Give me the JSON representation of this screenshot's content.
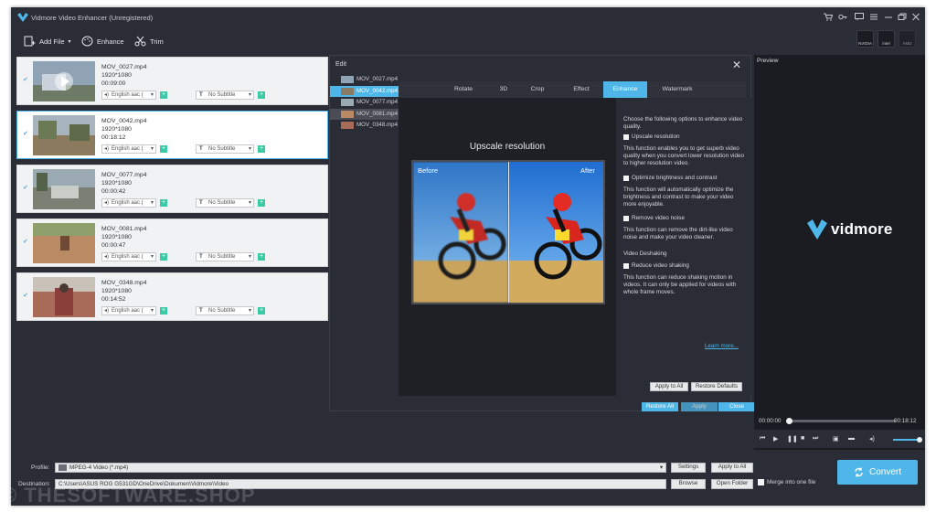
{
  "window": {
    "title": "Vidmore Video Enhancer (Unregistered)"
  },
  "title_icons": [
    "cart-icon",
    "key-icon",
    "chat-icon",
    "menu-icon",
    "minimize-icon",
    "restore-icon",
    "close-icon"
  ],
  "toolbar": {
    "add_file": "Add File",
    "enhance": "Enhance",
    "trim": "Trim"
  },
  "gpu_badges": [
    "NVIDIA",
    "intel",
    "AMD"
  ],
  "files": [
    {
      "name": "MOV_0027.mp4",
      "resolution": "1920*1080",
      "duration": "00:09:00",
      "audio": "English aac (",
      "subtitle": "No Subtitle"
    },
    {
      "name": "MOV_0042.mp4",
      "resolution": "1920*1080",
      "duration": "00:18:12",
      "audio": "English aac (",
      "subtitle": "No Subtitle"
    },
    {
      "name": "MOV_0077.mp4",
      "resolution": "1920*1080",
      "duration": "00:00:42",
      "audio": "English aac (",
      "subtitle": "No Subtitle"
    },
    {
      "name": "MOV_0081.mp4",
      "resolution": "1920*1080",
      "duration": "00:00:47",
      "audio": "English aac (",
      "subtitle": "No Subtitle"
    },
    {
      "name": "MOV_0348.mp4",
      "resolution": "1920*1080",
      "duration": "00:14:52",
      "audio": "English aac (",
      "subtitle": "No Subtitle"
    }
  ],
  "edit": {
    "title": "Edit",
    "file_list": [
      "MOV_0027.mp4",
      "MOV_0042.mp4",
      "MOV_0077.mp4",
      "MOV_0081.mp4",
      "MOV_0348.mp4"
    ],
    "tabs": [
      "Rotate",
      "3D",
      "Crop",
      "Effect",
      "Enhance",
      "Watermark"
    ],
    "active_tab": "Enhance",
    "preview_caption": "Upscale resolution",
    "before_label": "Before",
    "after_label": "After",
    "intro": "Choose the following options to enhance video quality.",
    "options": [
      {
        "label": "Upscale resolution",
        "desc": "This function enables you to get superb video quality when you convert lower resolution video to higher resolution video."
      },
      {
        "label": "Optimize brightness and contrast",
        "desc": "This function will automatically optimize the brightness and contrast to make your video more enjoyable."
      },
      {
        "label": "Remove video noise",
        "desc": "This function can remove the dirt-like video noise and make your video cleaner."
      },
      {
        "label": "Reduce video shaking",
        "desc": "This function can reduce shaking motion in videos. It can only be applied for videos with whole frame moves."
      }
    ],
    "deshaking_heading": "Video Deshaking",
    "learn_more": "Learn more...",
    "apply_to_all": "Apply to All",
    "restore_defaults": "Restore Defaults",
    "restore_all": "Restore All",
    "apply": "Apply",
    "close": "Close"
  },
  "preview": {
    "title": "Preview",
    "brand": "vidmore",
    "time_current": "00:00:00",
    "time_total": "00:18:12"
  },
  "bottom": {
    "profile_label": "Profile:",
    "profile_value": "MPEG-4 Video (*.mp4)",
    "settings": "Settings",
    "apply_to_all": "Apply to All",
    "destination_label": "Destination:",
    "destination_value": "C:\\Users\\ASUS ROG G531GD\\OneDrive\\Dokumen\\Vidmore\\Video",
    "browse": "Browse",
    "open_folder": "Open Folder",
    "merge": "Merge into one file",
    "convert": "Convert"
  },
  "watermark": "© THESOFTWARE.SHOP",
  "colors": {
    "accent": "#4fb6e9",
    "window_bg": "#2a2d36",
    "plus_green": "#39c9a4"
  }
}
